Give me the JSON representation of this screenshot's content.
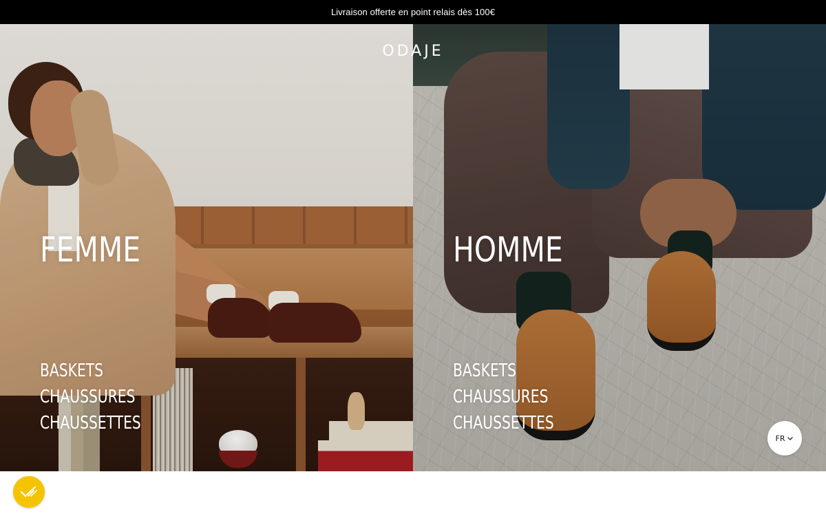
{
  "announcement": {
    "text": "Livraison offerte en point relais dès 100€"
  },
  "brand": {
    "logo": "ODAJE"
  },
  "panels": [
    {
      "title": "FEMME",
      "links": [
        "BASKETS",
        "CHAUSSURES",
        "CHAUSSETTES"
      ]
    },
    {
      "title": "HOMME",
      "links": [
        "BASKETS",
        "CHAUSSURES",
        "CHAUSSETTES"
      ]
    }
  ],
  "language": {
    "selected": "FR",
    "icon": "chevron-down-icon"
  },
  "floating_badge": {
    "icon": "checkmark-lines-icon",
    "color": "#f5c400"
  },
  "colors": {
    "announcement_bg": "#000000",
    "text_light": "#ffffff"
  }
}
